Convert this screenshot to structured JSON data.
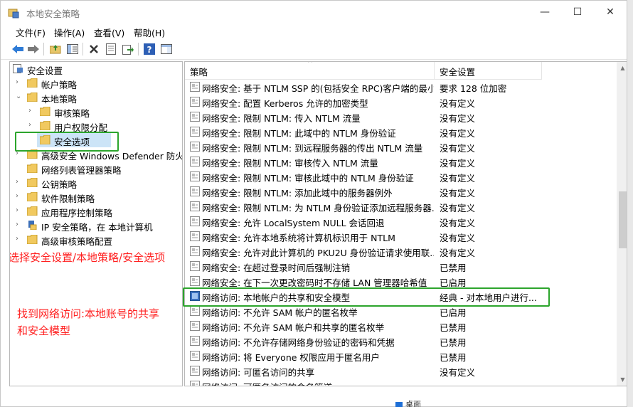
{
  "window": {
    "title": "本地安全策略"
  },
  "window_controls": {
    "minimize": "—",
    "maximize": "☐",
    "close": "✕"
  },
  "menu": [
    "文件(F)",
    "操作(A)",
    "查看(V)",
    "帮助(H)"
  ],
  "toolbar": {
    "buttons": [
      "back-icon",
      "forward-icon",
      "up-folder-icon",
      "show-hide-tree-icon",
      "delete-icon",
      "properties-icon",
      "export-icon",
      "help-icon",
      "panel-icon"
    ]
  },
  "tree": {
    "items": [
      {
        "label": "安全设置",
        "arrow": "",
        "level": 0,
        "icon": "security-settings-icon"
      },
      {
        "label": "帐户策略",
        "arrow": "›",
        "level": 1,
        "icon": "folder-icon"
      },
      {
        "label": "本地策略",
        "arrow": "⌄",
        "level": 1,
        "icon": "folder-icon"
      },
      {
        "label": "审核策略",
        "arrow": "›",
        "level": 2,
        "icon": "folder-icon"
      },
      {
        "label": "用户权限分配",
        "arrow": "›",
        "level": 2,
        "icon": "folder-icon"
      },
      {
        "label": "安全选项",
        "arrow": "",
        "level": 2,
        "icon": "folder-icon",
        "selected": true
      },
      {
        "label": "高级安全 Windows Defender 防火墙",
        "arrow": "›",
        "level": 1,
        "icon": "folder-icon"
      },
      {
        "label": "网络列表管理器策略",
        "arrow": "",
        "level": 1,
        "icon": "folder-icon"
      },
      {
        "label": "公钥策略",
        "arrow": "›",
        "level": 1,
        "icon": "folder-icon"
      },
      {
        "label": "软件限制策略",
        "arrow": "›",
        "level": 1,
        "icon": "folder-icon"
      },
      {
        "label": "应用程序控制策略",
        "arrow": "›",
        "level": 1,
        "icon": "folder-icon"
      },
      {
        "label": "IP 安全策略，在 本地计算机",
        "arrow": "›",
        "level": 1,
        "icon": "ip-security-icon"
      },
      {
        "label": "高级审核策略配置",
        "arrow": "›",
        "level": 1,
        "icon": "folder-icon"
      }
    ]
  },
  "annotations": {
    "step1": "选择安全设置/本地策略/安全选项",
    "step2_line1": "找到网络访问:本地账号的共享",
    "step2_line2": "和安全模型"
  },
  "columns": {
    "policy": "策略",
    "setting": "安全设置",
    "sort_caret": "^"
  },
  "rows": [
    {
      "policy": "网络安全: 基于 NTLM SSP 的(包括安全 RPC)客户端的最小...",
      "setting": "要求 128 位加密"
    },
    {
      "policy": "网络安全: 配置 Kerberos 允许的加密类型",
      "setting": "没有定义"
    },
    {
      "policy": "网络安全: 限制 NTLM: 传入 NTLM 流量",
      "setting": "没有定义"
    },
    {
      "policy": "网络安全: 限制 NTLM: 此域中的 NTLM 身份验证",
      "setting": "没有定义"
    },
    {
      "policy": "网络安全: 限制 NTLM: 到远程服务器的传出 NTLM 流量",
      "setting": "没有定义"
    },
    {
      "policy": "网络安全: 限制 NTLM: 审核传入 NTLM 流量",
      "setting": "没有定义"
    },
    {
      "policy": "网络安全: 限制 NTLM: 审核此域中的 NTLM 身份验证",
      "setting": "没有定义"
    },
    {
      "policy": "网络安全: 限制 NTLM: 添加此域中的服务器例外",
      "setting": "没有定义"
    },
    {
      "policy": "网络安全: 限制 NTLM: 为 NTLM 身份验证添加远程服务器...",
      "setting": "没有定义"
    },
    {
      "policy": "网络安全: 允许 LocalSystem NULL 会话回退",
      "setting": "没有定义"
    },
    {
      "policy": "网络安全: 允许本地系统将计算机标识用于 NTLM",
      "setting": "没有定义"
    },
    {
      "policy": "网络安全: 允许对此计算机的 PKU2U 身份验证请求使用联...",
      "setting": "没有定义"
    },
    {
      "policy": "网络安全: 在超过登录时间后强制注销",
      "setting": "已禁用"
    },
    {
      "policy": "网络安全: 在下一次更改密码时不存储 LAN 管理器哈希值",
      "setting": "已启用"
    },
    {
      "policy": "网络访问: 本地帐户的共享和安全模型",
      "setting": "经典 - 对本地用户进行...",
      "highlight": true
    },
    {
      "policy": "网络访问: 不允许 SAM 帐户的匿名枚举",
      "setting": "已启用"
    },
    {
      "policy": "网络访问: 不允许 SAM 帐户和共享的匿名枚举",
      "setting": "已禁用"
    },
    {
      "policy": "网络访问: 不允许存储网络身份验证的密码和凭据",
      "setting": "已禁用"
    },
    {
      "policy": "网络访问: 将 Everyone 权限应用于匿名用户",
      "setting": "已禁用"
    },
    {
      "policy": "网络访问: 可匿名访问的共享",
      "setting": "没有定义"
    },
    {
      "policy": "网络访问: 可匿名访问的命名管道",
      "setting": ""
    }
  ],
  "desktop_peek": {
    "label": "桌面"
  },
  "colors": {
    "annotation": "#ff2020",
    "highlight_box": "#2ca52c"
  }
}
